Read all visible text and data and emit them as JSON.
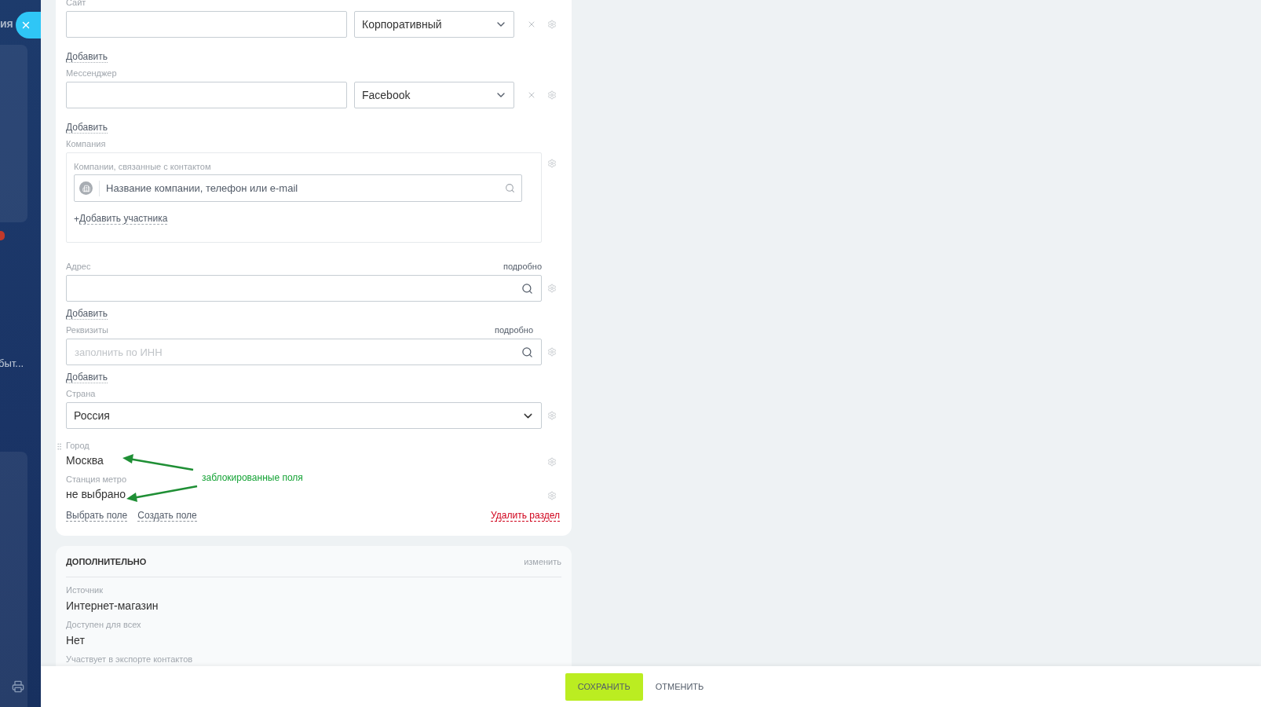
{
  "sidebar": {
    "title_fragment": "ия",
    "item_fragment": "быт..."
  },
  "main_section": {
    "fields": [
      {
        "kind": "multi",
        "label": "Сайт",
        "type": "Корпоративный",
        "add_link": "Добавить"
      },
      {
        "kind": "multi",
        "label": "Мессенджер",
        "type": "Facebook",
        "add_link": "Добавить"
      },
      {
        "kind": "company",
        "label": "Компания",
        "sublabel": "Компании, связанные с контактом",
        "placeholder": "Название компании, телефон или e-mail",
        "add_sign": "+",
        "add_link": "Добавить участника"
      },
      {
        "kind": "search",
        "label": "Адрес",
        "detail_link": "подробно",
        "add_link": "Добавить"
      },
      {
        "kind": "search",
        "label": "Реквизиты",
        "detail_link": "подробно",
        "placeholder": "заполнить по ИНН",
        "add_link": "Добавить"
      },
      {
        "kind": "select",
        "label": "Страна",
        "value": "Россия"
      },
      {
        "kind": "readonly",
        "label": "Город",
        "value": "Москва",
        "drag_handle": true
      },
      {
        "kind": "readonly",
        "label": "Станция метро",
        "value": "не выбрано",
        "drag_handle": false
      }
    ],
    "links": [
      "Выбрать поле",
      "Создать поле"
    ],
    "delete_link": "Удалить раздел"
  },
  "annotation": {
    "text": "заблокированные поля"
  },
  "additional_section": {
    "title": "ДОПОЛНИТЕЛЬНО",
    "edit_link": "изменить",
    "fields": [
      {
        "label": "Источник",
        "value": "Интернет-магазин"
      },
      {
        "label": "Доступен для всех",
        "value": "Нет"
      },
      {
        "label": "Участвует в экспорте контактов"
      }
    ]
  },
  "footer": {
    "save": "СОХРАНИТЬ",
    "cancel": "ОТМЕНИТЬ"
  }
}
